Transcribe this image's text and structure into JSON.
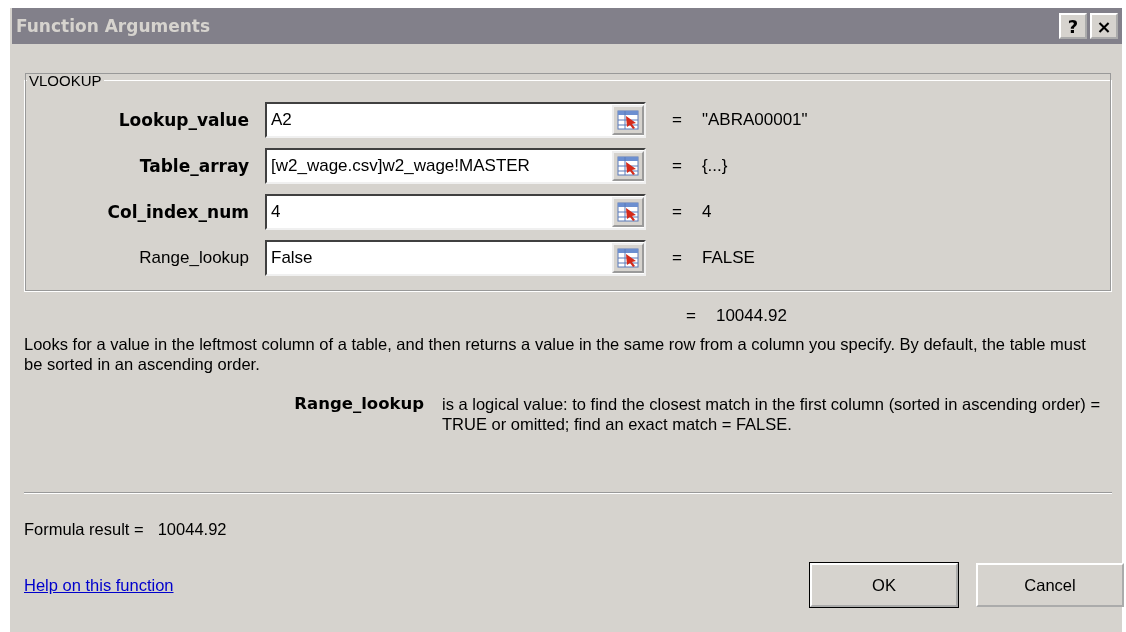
{
  "window": {
    "title": "Function Arguments",
    "help_button": "?",
    "close_button": "×"
  },
  "group": {
    "title": "VLOOKUP",
    "arguments": [
      {
        "label": "Lookup_value",
        "required": true,
        "value": "A2",
        "equals": "=",
        "result": "\"ABRA00001\""
      },
      {
        "label": "Table_array",
        "required": true,
        "value": "[w2_wage.csv]w2_wage!MASTER",
        "equals": "=",
        "result": "{...}"
      },
      {
        "label": "Col_index_num",
        "required": true,
        "value": "4",
        "equals": "=",
        "result": "4"
      },
      {
        "label": "Range_lookup",
        "required": false,
        "value": "False",
        "equals": "=",
        "result": "FALSE"
      }
    ]
  },
  "function_result": {
    "equals": "=",
    "value": "10044.92"
  },
  "description": "Looks for a value in the leftmost column of a table, and then returns a value in the same row from a column you specify. By default, the table must be sorted in an ascending order.",
  "argument_help": {
    "name": "Range_lookup",
    "text": "is a logical value: to find the closest match in the first column (sorted in ascending order) = TRUE or omitted; find an exact match = FALSE."
  },
  "formula_result": {
    "label": "Formula result =",
    "value": "10044.92"
  },
  "help_link": "Help on this function",
  "buttons": [
    "OK",
    "Cancel"
  ]
}
